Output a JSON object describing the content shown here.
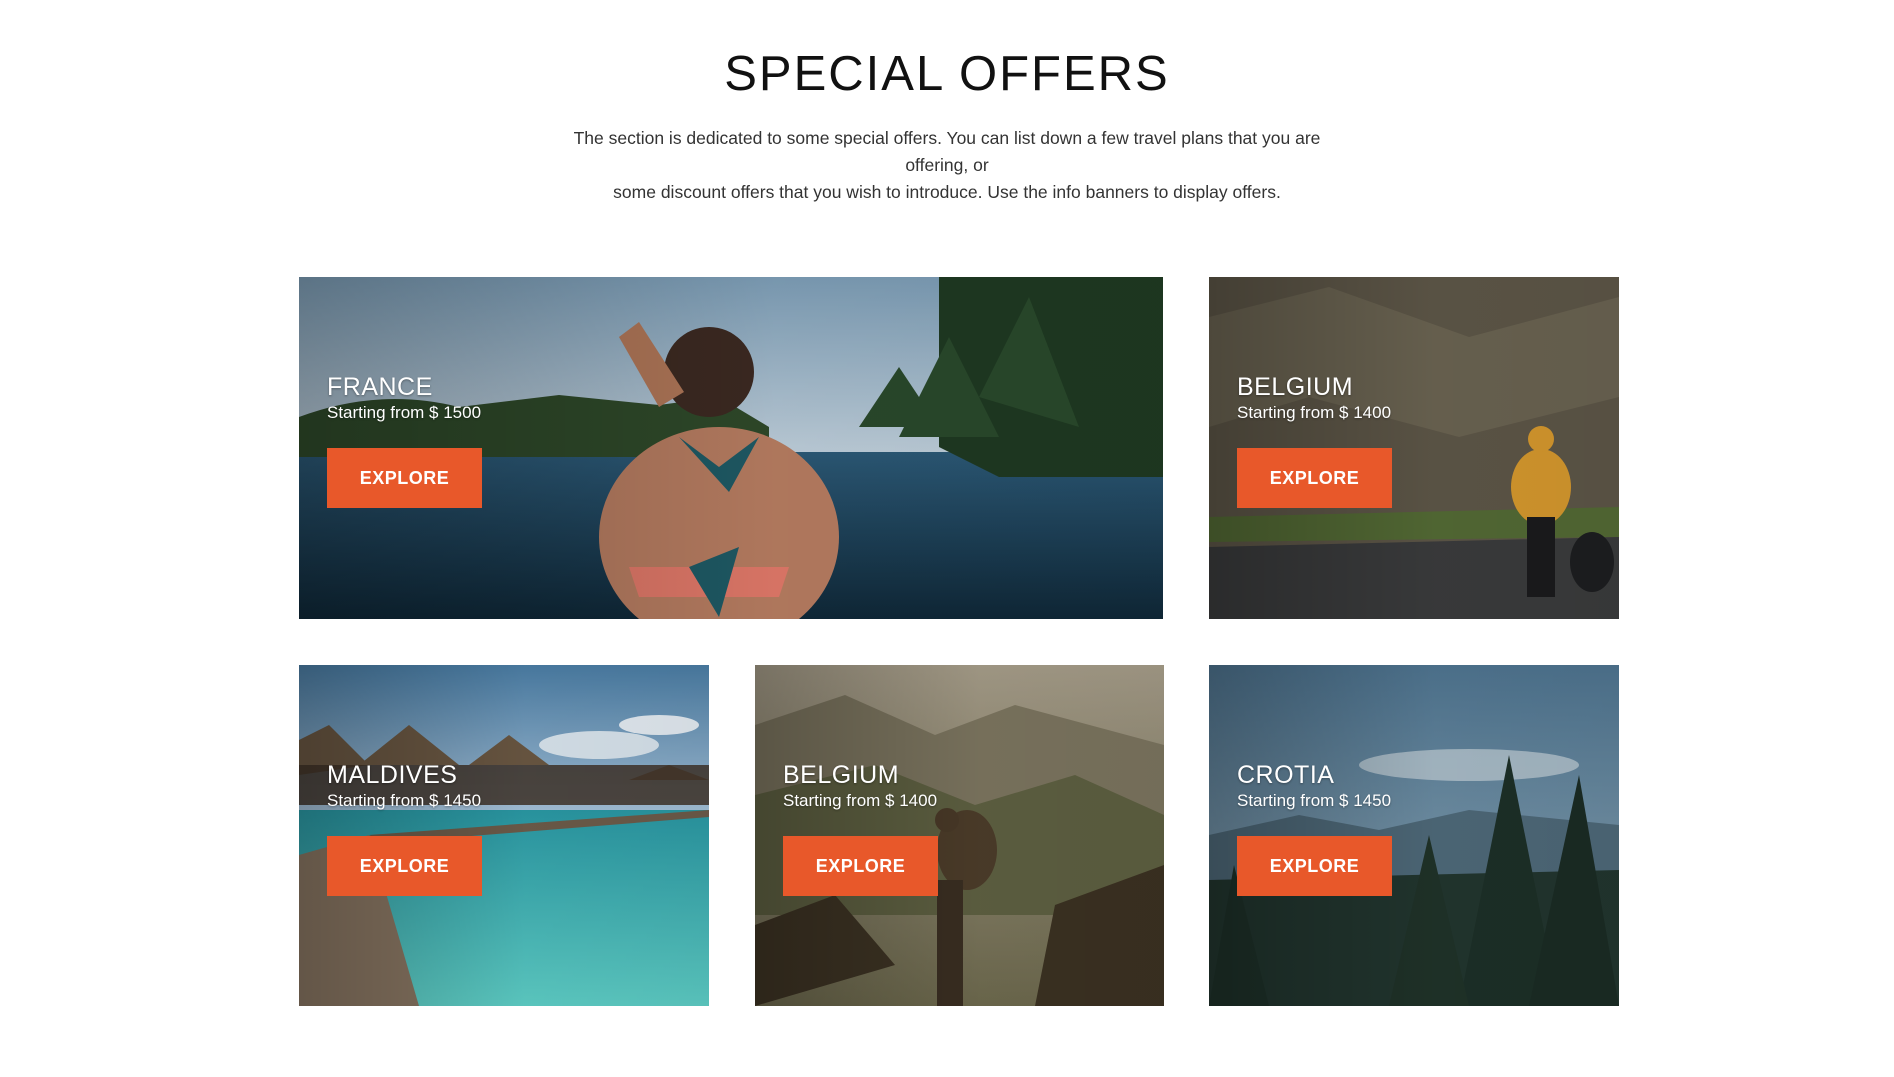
{
  "section": {
    "title": "SPECIAL OFFERS",
    "description_line1": "The section is dedicated to some special offers. You can list down a few travel plans that you are offering, or",
    "description_line2": "some discount offers that you wish to introduce. Use the info banners to display offers."
  },
  "colors": {
    "accent": "#e8582a",
    "heading": "#111111",
    "body_text": "#333333"
  },
  "offers": [
    {
      "destination": "FRANCE",
      "price": "Starting from $ 1500",
      "button": "EXPLORE",
      "scene": "lake-kayak-photo"
    },
    {
      "destination": "BELGIUM",
      "price": "Starting from $ 1400",
      "button": "EXPLORE",
      "scene": "hiker-road-photo"
    },
    {
      "destination": "MALDIVES",
      "price": "Starting from $ 1450",
      "button": "EXPLORE",
      "scene": "overwater-huts-photo"
    },
    {
      "destination": "BELGIUM",
      "price": "Starting from $ 1400",
      "button": "EXPLORE",
      "scene": "mountain-hiker-photo"
    },
    {
      "destination": "CROTIA",
      "price": "Starting from $ 1450",
      "button": "EXPLORE",
      "scene": "pine-forest-photo"
    }
  ]
}
